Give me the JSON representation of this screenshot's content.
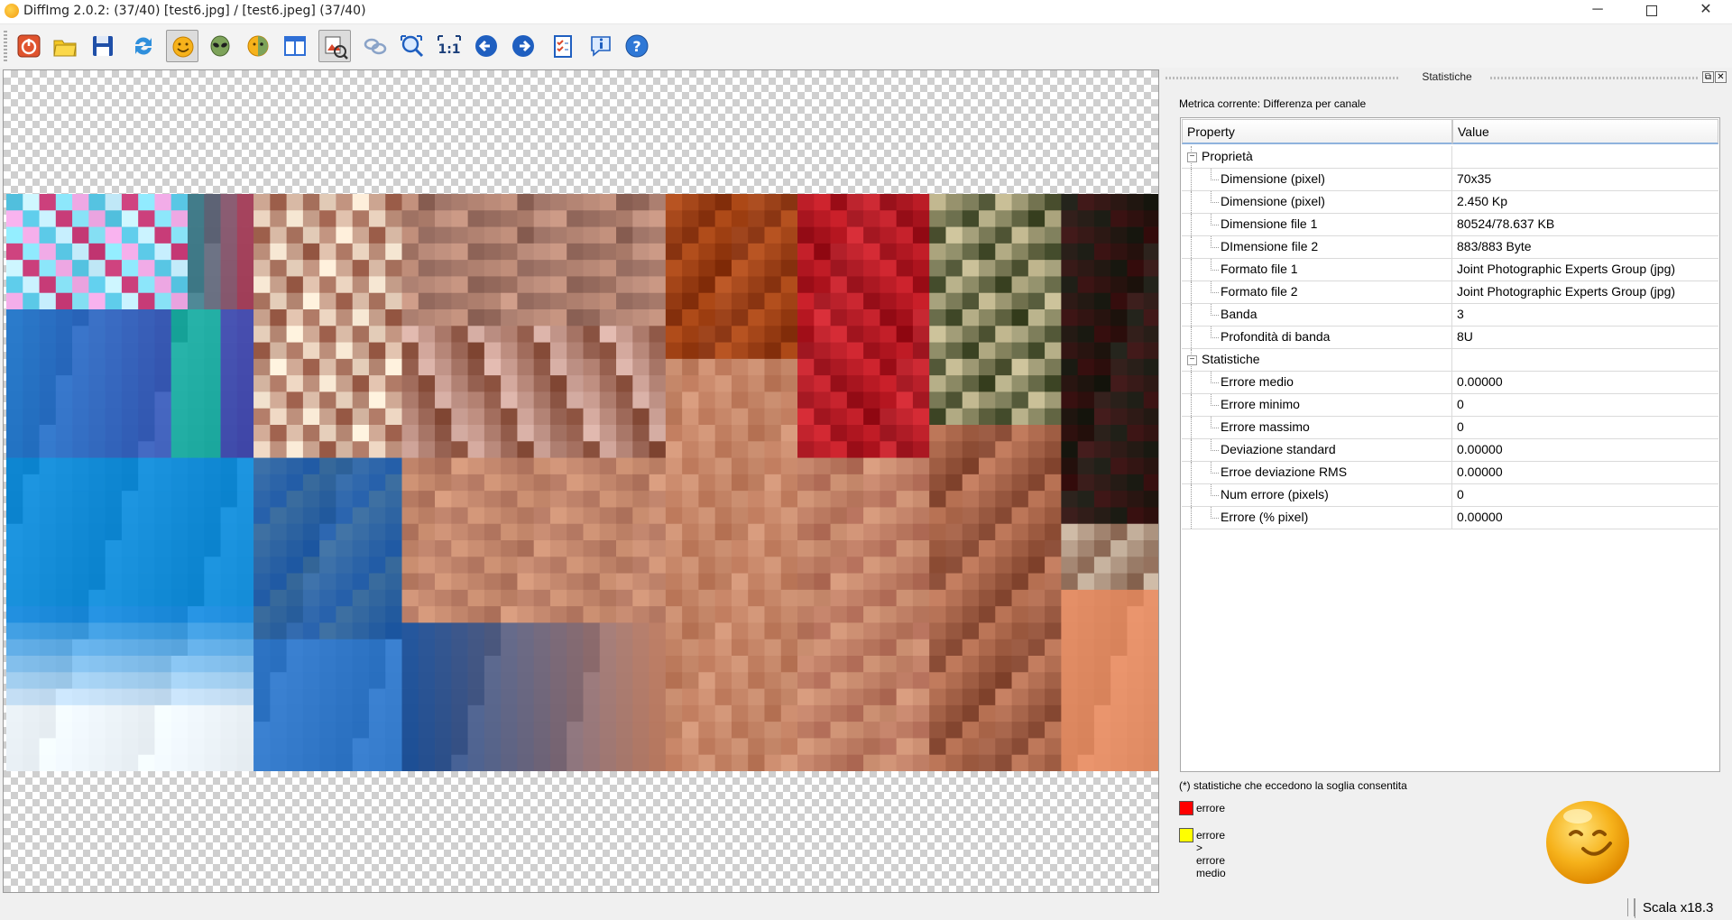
{
  "window": {
    "title": "DiffImg 2.0.2:  (37/40) [test6.jpg] / [test6.jpeg] (37/40)",
    "minimize": "─",
    "close": "✕"
  },
  "toolbar": {
    "buttons": [
      {
        "icon": "quit-icon"
      },
      {
        "icon": "open-folder-icon"
      },
      {
        "icon": "save-icon"
      },
      {
        "icon": "refresh-icon"
      },
      {
        "icon": "smiley-icon"
      },
      {
        "icon": "alien-icon"
      },
      {
        "icon": "mixed-smiley-icon"
      },
      {
        "icon": "dual-panel-icon"
      },
      {
        "icon": "difference-view-icon"
      },
      {
        "icon": "link-icon"
      },
      {
        "icon": "zoom-fit-icon"
      },
      {
        "icon": "zoom-1to1-icon"
      },
      {
        "icon": "previous-icon"
      },
      {
        "icon": "next-icon"
      },
      {
        "icon": "checklist-icon"
      },
      {
        "icon": "info-icon"
      },
      {
        "icon": "help-icon"
      }
    ],
    "zoom_label": "1:1"
  },
  "dock": {
    "title": "Statistiche",
    "float_glyph": "⧉",
    "close_glyph": "✕",
    "metric_label": "Metrica corrente: Differenza per canale"
  },
  "table": {
    "headers": [
      "Property",
      "Value"
    ],
    "rows": [
      {
        "type": "group",
        "label": "Proprietà",
        "value": "",
        "expander": "−"
      },
      {
        "type": "child",
        "label": "Dimensione (pixel)",
        "value": "70x35"
      },
      {
        "type": "child",
        "label": "Dimensione (pixel)",
        "value": "2.450 Kp"
      },
      {
        "type": "child",
        "label": "Dimensione file 1",
        "value": "80524/78.637 KB"
      },
      {
        "type": "child",
        "label": "DImensione file 2",
        "value": "883/883 Byte"
      },
      {
        "type": "child",
        "label": "Formato file 1",
        "value": "Joint Photographic Experts Group (jpg)"
      },
      {
        "type": "child",
        "label": "Formato file 2",
        "value": "Joint Photographic Experts Group (jpg)"
      },
      {
        "type": "child",
        "label": "Banda",
        "value": "3"
      },
      {
        "type": "child",
        "label": "Profondità di banda",
        "value": "8U"
      },
      {
        "type": "group",
        "label": "Statistiche",
        "value": "",
        "expander": "−"
      },
      {
        "type": "child",
        "label": "Errore medio",
        "value": "0.00000"
      },
      {
        "type": "child",
        "label": "Errore minimo",
        "value": "0"
      },
      {
        "type": "child",
        "label": "Errore massimo",
        "value": "0"
      },
      {
        "type": "child",
        "label": "Deviazione standard",
        "value": "0.00000"
      },
      {
        "type": "child",
        "label": "Erroe deviazione RMS",
        "value": "0.00000"
      },
      {
        "type": "child",
        "label": "Num errore (pixels)",
        "value": "0"
      },
      {
        "type": "child",
        "label": "Errore (% pixel)",
        "value": "0.00000"
      }
    ]
  },
  "legend": {
    "note": "(*) statistiche che eccedono la soglia consentita",
    "error_label": "errore",
    "error_color": "#ff0000",
    "above_mean_label": "errore > errore medio",
    "above_mean_color": "#ffff00"
  },
  "status": {
    "scale": "Scala x18.3"
  },
  "palette": {
    "accent_blue": "#2f6fd6",
    "smiley_yellow": "#f6b21b"
  }
}
